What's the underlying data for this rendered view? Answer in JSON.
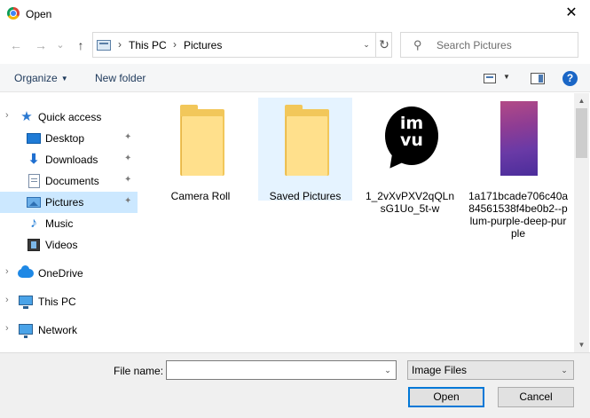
{
  "window": {
    "title": "Open",
    "close_glyph": "✕",
    "icon": "chrome-app-icon"
  },
  "nav_buttons": {
    "back": "←",
    "forward": "→",
    "recent": "⌄",
    "up": "↑"
  },
  "address": {
    "icon": "this-pc-pictures-icon",
    "segments": [
      "This PC",
      "Pictures"
    ],
    "separator": "›",
    "dropdown_glyph": "⌄",
    "refresh_glyph": "↻"
  },
  "search": {
    "placeholder": "Search Pictures",
    "icon_glyph": "⚲"
  },
  "toolbar": {
    "organize_label": "Organize",
    "organize_caret": "▼",
    "new_folder_label": "New folder",
    "view_caret": "▼",
    "help_glyph": "?"
  },
  "nav_pane": {
    "caret_collapsed": "›",
    "pin_glyph": "📌",
    "items": [
      {
        "label": "Quick access",
        "icon": "star-icon"
      },
      {
        "label": "Desktop",
        "icon": "desktop-icon",
        "pinned": true
      },
      {
        "label": "Downloads",
        "icon": "downloads-icon",
        "pinned": true
      },
      {
        "label": "Documents",
        "icon": "documents-icon",
        "pinned": true
      },
      {
        "label": "Pictures",
        "icon": "pictures-icon",
        "pinned": true,
        "selected": true
      },
      {
        "label": "Music",
        "icon": "music-icon"
      },
      {
        "label": "Videos",
        "icon": "videos-icon"
      },
      {
        "label": "OneDrive",
        "icon": "onedrive-icon"
      },
      {
        "label": "This PC",
        "icon": "this-pc-icon"
      },
      {
        "label": "Network",
        "icon": "network-icon"
      }
    ]
  },
  "files": [
    {
      "name": "Camera Roll",
      "type": "folder"
    },
    {
      "name": "Saved Pictures",
      "type": "folder",
      "selected": true
    },
    {
      "name": "1_2vXvPXV2qQLnsG1Uo_5t-w",
      "type": "image",
      "thumb_text": "im\nvu"
    },
    {
      "name": "1a171bcade706c40a84561538f4be0b2--plum-purple-deep-purple",
      "type": "image"
    }
  ],
  "scrollbar": {
    "up_glyph": "▲",
    "down_glyph": "▼"
  },
  "footer": {
    "file_name_label": "File name:",
    "file_name_value": "",
    "dropdown_glyph": "⌄",
    "file_type_value": "Image Files",
    "open_label": "Open",
    "cancel_label": "Cancel"
  },
  "colors": {
    "selection": "#cce8ff",
    "hover_tile": "#e5f3ff",
    "folder": "#ffe08c",
    "accent": "#0078d7"
  }
}
